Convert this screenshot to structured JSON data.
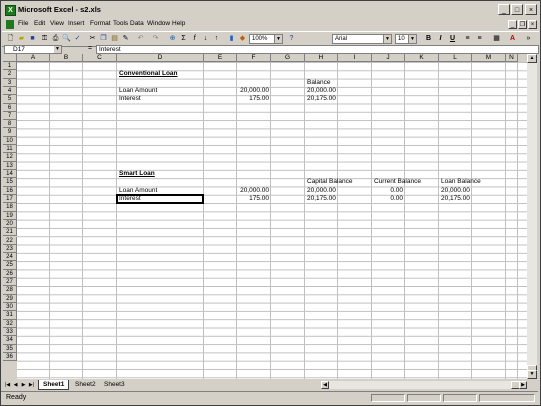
{
  "window": {
    "title": "Microsoft Excel - s2.xls",
    "minimize": "_",
    "maximize": "□",
    "close": "×"
  },
  "menu": {
    "items": [
      "File",
      "Edit",
      "View",
      "Insert",
      "Format",
      "Tools",
      "Data",
      "Window",
      "Help"
    ],
    "mdi": [
      "_",
      "❐",
      "×"
    ]
  },
  "toolbar": {
    "zoom": "100%",
    "font": "Arial",
    "font_size": "10",
    "bold": "B",
    "italic": "I",
    "underline": "U"
  },
  "formula_bar": {
    "name_box": "D17",
    "equals": "=",
    "formula": "Interest"
  },
  "columns": [
    "A",
    "B",
    "C",
    "D",
    "E",
    "F",
    "G",
    "H",
    "I",
    "J",
    "K",
    "L",
    "M",
    "N"
  ],
  "rows": [
    "1",
    "2",
    "3",
    "4",
    "5",
    "6",
    "7",
    "8",
    "9",
    "10",
    "11",
    "12",
    "13",
    "14",
    "15",
    "16",
    "17",
    "18",
    "19",
    "20",
    "21",
    "22",
    "23",
    "24",
    "25",
    "26",
    "27",
    "28",
    "29",
    "30",
    "31",
    "32",
    "33",
    "34",
    "35",
    "36"
  ],
  "cells": {
    "D2": "Conventional Loan",
    "H3": "Balance",
    "D4": "Loan Amount",
    "F4": "20,000.00",
    "H4": "20,000.00",
    "D5": "Interest",
    "F5": "175.00",
    "H5": "20,175.00",
    "D14": "Smart Loan",
    "H15": "Capital Balance",
    "J15": "Current Balance",
    "L15": "Loan Balance",
    "D16": "Loan Amount",
    "F16": "20,000.00",
    "H16": "20,000.00",
    "J16": "0.00",
    "L16": "20,000.00",
    "D17": "Interest",
    "F17": "175.00",
    "H17": "20,175.00",
    "J17": "0.00",
    "L17": "20,175.00"
  },
  "sheets": [
    "Sheet1",
    "Sheet2",
    "Sheet3"
  ],
  "active_sheet": "Sheet1",
  "status": "Ready"
}
